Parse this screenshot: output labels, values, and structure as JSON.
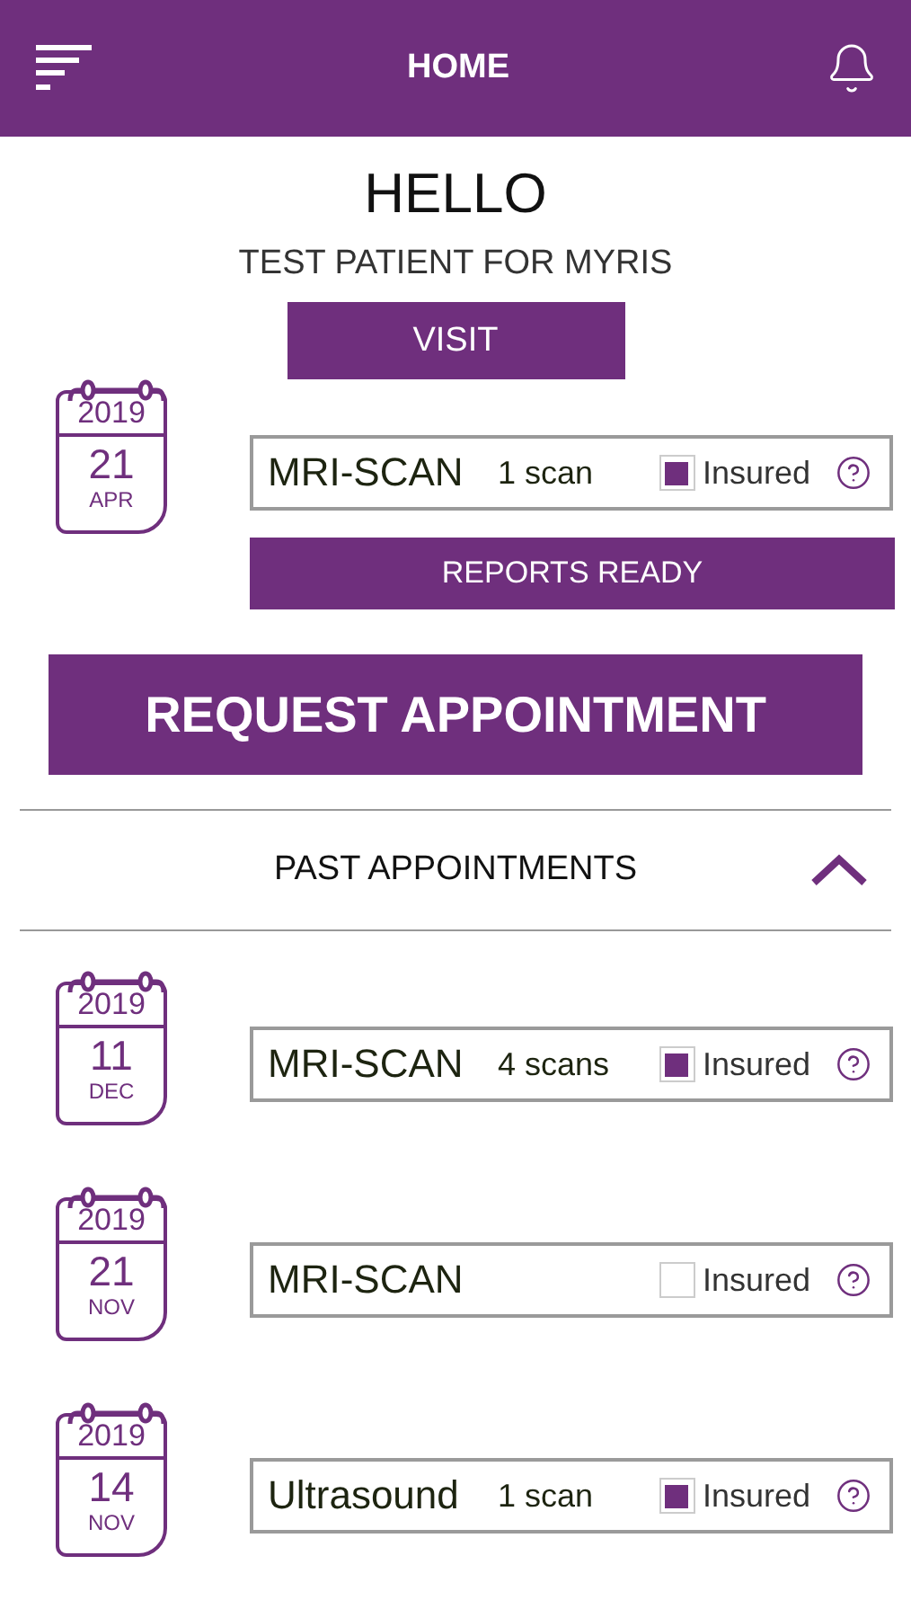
{
  "header": {
    "title": "HOME"
  },
  "greeting": "HELLO",
  "patient": "TEST PATIENT FOR MYRIS",
  "upcoming": {
    "label": "VISIT",
    "appointment": {
      "year": "2019",
      "day": "21",
      "month": "APR",
      "exam": "MRI-SCAN",
      "count": "1 scan",
      "insured": true,
      "insured_label": "Insured"
    },
    "action": "REPORTS READY"
  },
  "request_button": "REQUEST APPOINTMENT",
  "past": {
    "title": "PAST APPOINTMENTS",
    "expanded": true,
    "appointments": [
      {
        "year": "2019",
        "day": "11",
        "month": "DEC",
        "exam": "MRI-SCAN",
        "count": "4 scans",
        "insured": true,
        "insured_label": "Insured"
      },
      {
        "year": "2019",
        "day": "21",
        "month": "NOV",
        "exam": "MRI-SCAN",
        "insured": false,
        "insured_label": "Insured"
      },
      {
        "year": "2019",
        "day": "14",
        "month": "NOV",
        "exam": "Ultrasound",
        "count": "1 scan",
        "insured": true,
        "insured_label": "Insured"
      }
    ]
  }
}
